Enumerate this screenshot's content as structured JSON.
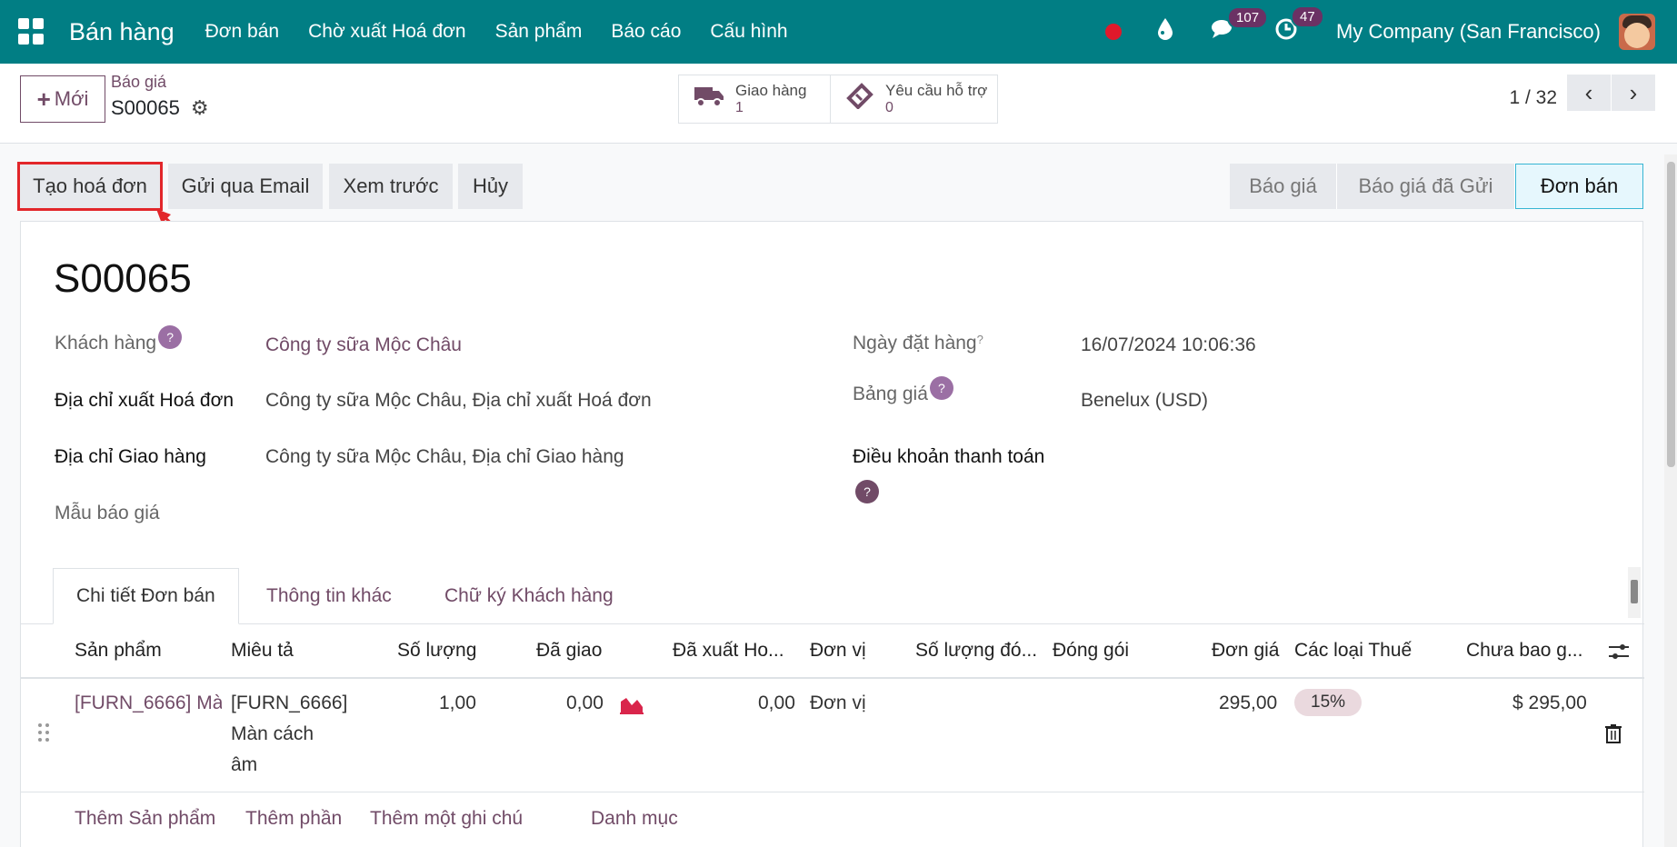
{
  "nav": {
    "app_name": "Bán hàng",
    "menu": [
      "Đơn bán",
      "Chờ xuất Hoá đơn",
      "Sản phẩm",
      "Báo cáo",
      "Cấu hình"
    ],
    "messages_count": "107",
    "activities_count": "47",
    "company": "My Company (San Francisco)"
  },
  "control": {
    "new_label": "Mới",
    "breadcrumb": "Báo giá",
    "record_name": "S00065",
    "delivery_label": "Giao hàng",
    "delivery_count": "1",
    "support_label": "Yêu cầu hỗ trợ",
    "support_count": "0",
    "pager": "1 / 32"
  },
  "actions": {
    "create_invoice": "Tạo hoá đơn",
    "send_email": "Gửi qua Email",
    "preview": "Xem trước",
    "cancel": "Hủy"
  },
  "statusbar": [
    "Báo giá",
    "Báo giá đã Gửi",
    "Đơn bán"
  ],
  "form": {
    "title": "S00065",
    "customer_label": "Khách hàng",
    "customer_value": "Công ty sữa Mộc Châu",
    "invoice_addr_label": "Địa chỉ xuất Hoá đơn",
    "invoice_addr_value": "Công ty sữa Mộc Châu, Địa chỉ xuất Hoá đơn",
    "delivery_addr_label": "Địa chỉ Giao hàng",
    "delivery_addr_value": "Công ty sữa Mộc Châu, Địa chỉ Giao hàng",
    "template_label": "Mẫu báo giá",
    "order_date_label": "Ngày đặt hàng",
    "order_date_value": "16/07/2024 10:06:36",
    "pricelist_label": "Bảng giá",
    "pricelist_value": "Benelux (USD)",
    "payment_terms_label": "Điều khoản thanh toán"
  },
  "tabs": [
    "Chi tiết Đơn bán",
    "Thông tin khác",
    "Chữ ký Khách hàng"
  ],
  "table": {
    "headers": [
      "Sản phẩm",
      "Miêu tả",
      "Số lượng",
      "Đã giao",
      "Đã xuất Ho...",
      "Đơn vị",
      "Số lượng đó...",
      "Đóng gói",
      "Đơn giá",
      "Các loại Thuế",
      "Chưa bao g..."
    ],
    "row": {
      "product": "[FURN_6666] Mà",
      "desc_line1": "[FURN_6666]",
      "desc_line2": "Màn cách",
      "desc_line3": "âm",
      "qty": "1,00",
      "delivered": "0,00",
      "invoiced": "0,00",
      "uom": "Đơn vị",
      "price": "295,00",
      "tax": "15%",
      "subtotal": "$ 295,00"
    },
    "add_links": [
      "Thêm Sản phẩm",
      "Thêm phần",
      "Thêm một ghi chú",
      "Danh mục"
    ]
  },
  "help_mark": "?",
  "icons": [
    "apps-icon",
    "record-dot-icon",
    "drop-icon",
    "chat-icon",
    "clock-icon",
    "gear-icon",
    "truck-icon",
    "ticket-icon",
    "chevron-left-icon",
    "chevron-right-icon",
    "settings-sliders-icon",
    "drag-handle-icon",
    "trash-icon",
    "area-chart-icon"
  ]
}
